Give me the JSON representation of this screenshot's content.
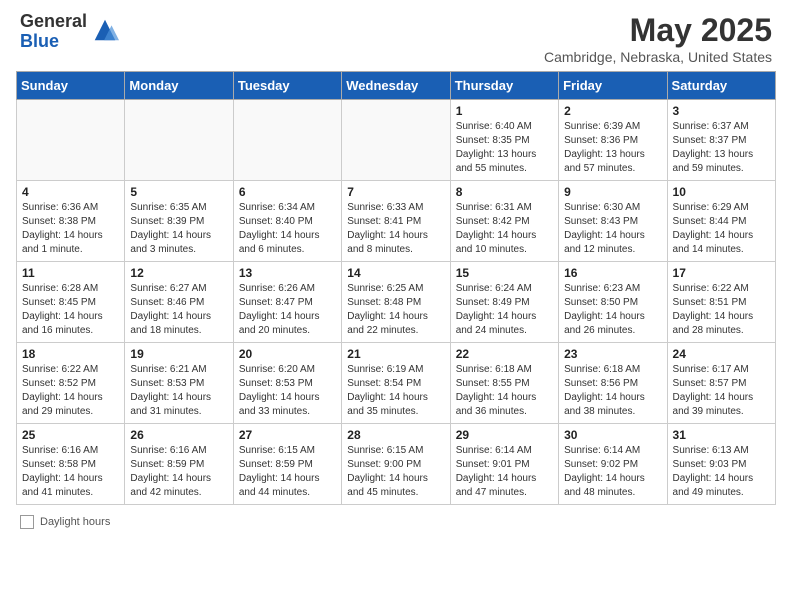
{
  "header": {
    "logo_general": "General",
    "logo_blue": "Blue",
    "title": "May 2025",
    "location": "Cambridge, Nebraska, United States"
  },
  "days_of_week": [
    "Sunday",
    "Monday",
    "Tuesday",
    "Wednesday",
    "Thursday",
    "Friday",
    "Saturday"
  ],
  "footer": {
    "label": "Daylight hours"
  },
  "weeks": [
    [
      {
        "day": "",
        "info": ""
      },
      {
        "day": "",
        "info": ""
      },
      {
        "day": "",
        "info": ""
      },
      {
        "day": "",
        "info": ""
      },
      {
        "day": "1",
        "info": "Sunrise: 6:40 AM\nSunset: 8:35 PM\nDaylight: 13 hours\nand 55 minutes."
      },
      {
        "day": "2",
        "info": "Sunrise: 6:39 AM\nSunset: 8:36 PM\nDaylight: 13 hours\nand 57 minutes."
      },
      {
        "day": "3",
        "info": "Sunrise: 6:37 AM\nSunset: 8:37 PM\nDaylight: 13 hours\nand 59 minutes."
      }
    ],
    [
      {
        "day": "4",
        "info": "Sunrise: 6:36 AM\nSunset: 8:38 PM\nDaylight: 14 hours\nand 1 minute."
      },
      {
        "day": "5",
        "info": "Sunrise: 6:35 AM\nSunset: 8:39 PM\nDaylight: 14 hours\nand 3 minutes."
      },
      {
        "day": "6",
        "info": "Sunrise: 6:34 AM\nSunset: 8:40 PM\nDaylight: 14 hours\nand 6 minutes."
      },
      {
        "day": "7",
        "info": "Sunrise: 6:33 AM\nSunset: 8:41 PM\nDaylight: 14 hours\nand 8 minutes."
      },
      {
        "day": "8",
        "info": "Sunrise: 6:31 AM\nSunset: 8:42 PM\nDaylight: 14 hours\nand 10 minutes."
      },
      {
        "day": "9",
        "info": "Sunrise: 6:30 AM\nSunset: 8:43 PM\nDaylight: 14 hours\nand 12 minutes."
      },
      {
        "day": "10",
        "info": "Sunrise: 6:29 AM\nSunset: 8:44 PM\nDaylight: 14 hours\nand 14 minutes."
      }
    ],
    [
      {
        "day": "11",
        "info": "Sunrise: 6:28 AM\nSunset: 8:45 PM\nDaylight: 14 hours\nand 16 minutes."
      },
      {
        "day": "12",
        "info": "Sunrise: 6:27 AM\nSunset: 8:46 PM\nDaylight: 14 hours\nand 18 minutes."
      },
      {
        "day": "13",
        "info": "Sunrise: 6:26 AM\nSunset: 8:47 PM\nDaylight: 14 hours\nand 20 minutes."
      },
      {
        "day": "14",
        "info": "Sunrise: 6:25 AM\nSunset: 8:48 PM\nDaylight: 14 hours\nand 22 minutes."
      },
      {
        "day": "15",
        "info": "Sunrise: 6:24 AM\nSunset: 8:49 PM\nDaylight: 14 hours\nand 24 minutes."
      },
      {
        "day": "16",
        "info": "Sunrise: 6:23 AM\nSunset: 8:50 PM\nDaylight: 14 hours\nand 26 minutes."
      },
      {
        "day": "17",
        "info": "Sunrise: 6:22 AM\nSunset: 8:51 PM\nDaylight: 14 hours\nand 28 minutes."
      }
    ],
    [
      {
        "day": "18",
        "info": "Sunrise: 6:22 AM\nSunset: 8:52 PM\nDaylight: 14 hours\nand 29 minutes."
      },
      {
        "day": "19",
        "info": "Sunrise: 6:21 AM\nSunset: 8:53 PM\nDaylight: 14 hours\nand 31 minutes."
      },
      {
        "day": "20",
        "info": "Sunrise: 6:20 AM\nSunset: 8:53 PM\nDaylight: 14 hours\nand 33 minutes."
      },
      {
        "day": "21",
        "info": "Sunrise: 6:19 AM\nSunset: 8:54 PM\nDaylight: 14 hours\nand 35 minutes."
      },
      {
        "day": "22",
        "info": "Sunrise: 6:18 AM\nSunset: 8:55 PM\nDaylight: 14 hours\nand 36 minutes."
      },
      {
        "day": "23",
        "info": "Sunrise: 6:18 AM\nSunset: 8:56 PM\nDaylight: 14 hours\nand 38 minutes."
      },
      {
        "day": "24",
        "info": "Sunrise: 6:17 AM\nSunset: 8:57 PM\nDaylight: 14 hours\nand 39 minutes."
      }
    ],
    [
      {
        "day": "25",
        "info": "Sunrise: 6:16 AM\nSunset: 8:58 PM\nDaylight: 14 hours\nand 41 minutes."
      },
      {
        "day": "26",
        "info": "Sunrise: 6:16 AM\nSunset: 8:59 PM\nDaylight: 14 hours\nand 42 minutes."
      },
      {
        "day": "27",
        "info": "Sunrise: 6:15 AM\nSunset: 8:59 PM\nDaylight: 14 hours\nand 44 minutes."
      },
      {
        "day": "28",
        "info": "Sunrise: 6:15 AM\nSunset: 9:00 PM\nDaylight: 14 hours\nand 45 minutes."
      },
      {
        "day": "29",
        "info": "Sunrise: 6:14 AM\nSunset: 9:01 PM\nDaylight: 14 hours\nand 47 minutes."
      },
      {
        "day": "30",
        "info": "Sunrise: 6:14 AM\nSunset: 9:02 PM\nDaylight: 14 hours\nand 48 minutes."
      },
      {
        "day": "31",
        "info": "Sunrise: 6:13 AM\nSunset: 9:03 PM\nDaylight: 14 hours\nand 49 minutes."
      }
    ]
  ]
}
